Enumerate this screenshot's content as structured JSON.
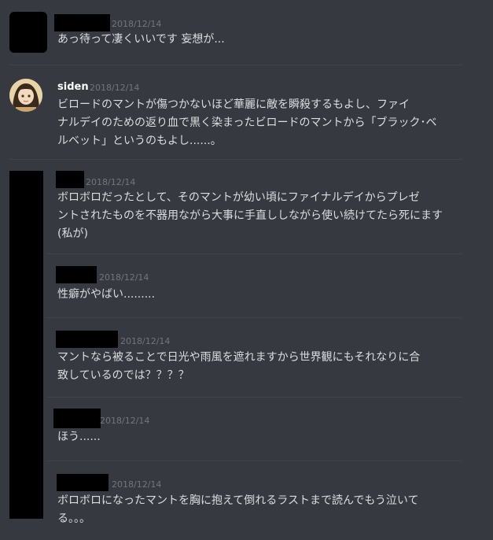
{
  "messages": [
    {
      "author": "",
      "timestamp": "2018/12/14",
      "lines": [
        "あっ待って凄くいいです 妄想が..."
      ]
    },
    {
      "author": "siden",
      "timestamp": "2018/12/14",
      "lines": [
        "ビロードのマントが傷つかないほど華麗に敵を瞬殺するもよし、ファイ",
        "ナルデイのための返り血で黒く染まったビロードのマントから「ブラック･ベ",
        "ルベット」というのもよし......。"
      ]
    },
    {
      "author": "",
      "timestamp": "2018/12/14",
      "lines": [
        "ボロボロだったとして、そのマントが幼い頃にファイナルデイからプレゼ",
        "ントされたものを不器用ながら大事に手直ししながら使い続けてたら死にます",
        "(私が)"
      ]
    },
    {
      "author": "",
      "timestamp": "2018/12/14",
      "lines": [
        "性癖がやばい........."
      ]
    },
    {
      "author": "",
      "timestamp": "2018/12/14",
      "lines": [
        "マントなら被ることで日光や雨風を遮れますから世界観にもそれなりに合",
        "致しているのでは？？？？"
      ]
    },
    {
      "author": "",
      "timestamp": "2018/12/14",
      "lines": [
        "ほう......"
      ]
    },
    {
      "author": "",
      "timestamp": "2018/12/14",
      "lines": [
        "ボロボロになったマントを胸に抱えて倒れるラストまで読んでもう泣いて",
        "る。。。"
      ]
    }
  ]
}
